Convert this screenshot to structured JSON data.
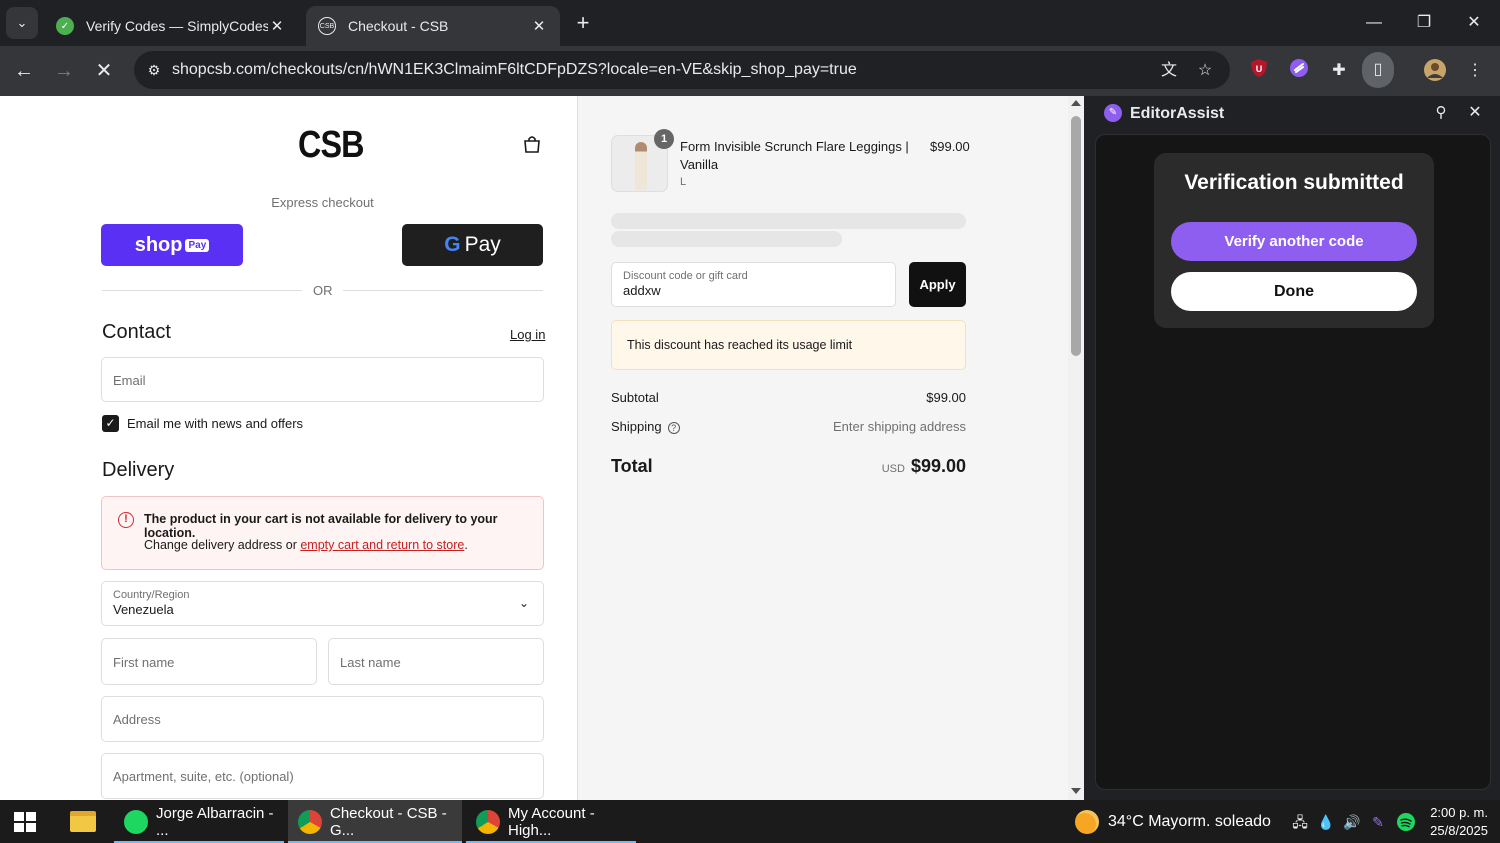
{
  "browser": {
    "tabs": [
      {
        "title": "Verify Codes — SimplyCodes",
        "active": false
      },
      {
        "title": "Checkout - CSB",
        "active": true
      }
    ],
    "url": "shopcsb.com/checkouts/cn/hWN1EK3ClmaimF6ltCDFpDZS?locale=en-VE&skip_shop_pay=true"
  },
  "checkout": {
    "logo": "CSB",
    "express_checkout": "Express checkout",
    "shop_pay_label": "shop",
    "shop_pay_badge": "Pay",
    "gpay_g": "G",
    "gpay_label": "Pay",
    "or": "OR",
    "contact_title": "Contact",
    "login": "Log in",
    "email_placeholder": "Email",
    "news_label": "Email me with news and offers",
    "news_checked": true,
    "delivery_title": "Delivery",
    "delivery_error_title": "The product in your cart is not available for delivery to your location.",
    "delivery_error_prefix": "Change delivery address or ",
    "delivery_error_link": "empty cart and return to store",
    "delivery_error_suffix": ".",
    "country_label": "Country/Region",
    "country_value": "Venezuela",
    "first_name_placeholder": "First name",
    "last_name_placeholder": "Last name",
    "address_placeholder": "Address",
    "apartment_placeholder": "Apartment, suite, etc. (optional)"
  },
  "summary": {
    "product": {
      "quantity": "1",
      "name": "Form Invisible Scrunch Flare Leggings | Vanilla",
      "variant": "L",
      "price": "$99.00"
    },
    "discount_label": "Discount code or gift card",
    "discount_value": "addxw",
    "apply": "Apply",
    "discount_error": "This discount has reached its usage limit",
    "subtotal_label": "Subtotal",
    "subtotal_value": "$99.00",
    "shipping_label": "Shipping",
    "shipping_value": "Enter shipping address",
    "total_label": "Total",
    "total_currency": "USD",
    "total_value": "$99.00"
  },
  "side_panel": {
    "title": "EditorAssist",
    "card_title": "Verification submitted",
    "verify_another": "Verify another code",
    "done": "Done",
    "accent": "#8e5ef0"
  },
  "taskbar": {
    "apps": [
      {
        "label": "Jorge Albarracin - ...",
        "icon": "spotify-icon"
      },
      {
        "label": "Checkout - CSB - G...",
        "icon": "chrome-icon",
        "active": true
      },
      {
        "label": "My Account - High...",
        "icon": "chrome-icon"
      }
    ],
    "weather": "34°C  Mayorm. soleado",
    "time": "2:00 p. m.",
    "date": "25/8/2025"
  }
}
